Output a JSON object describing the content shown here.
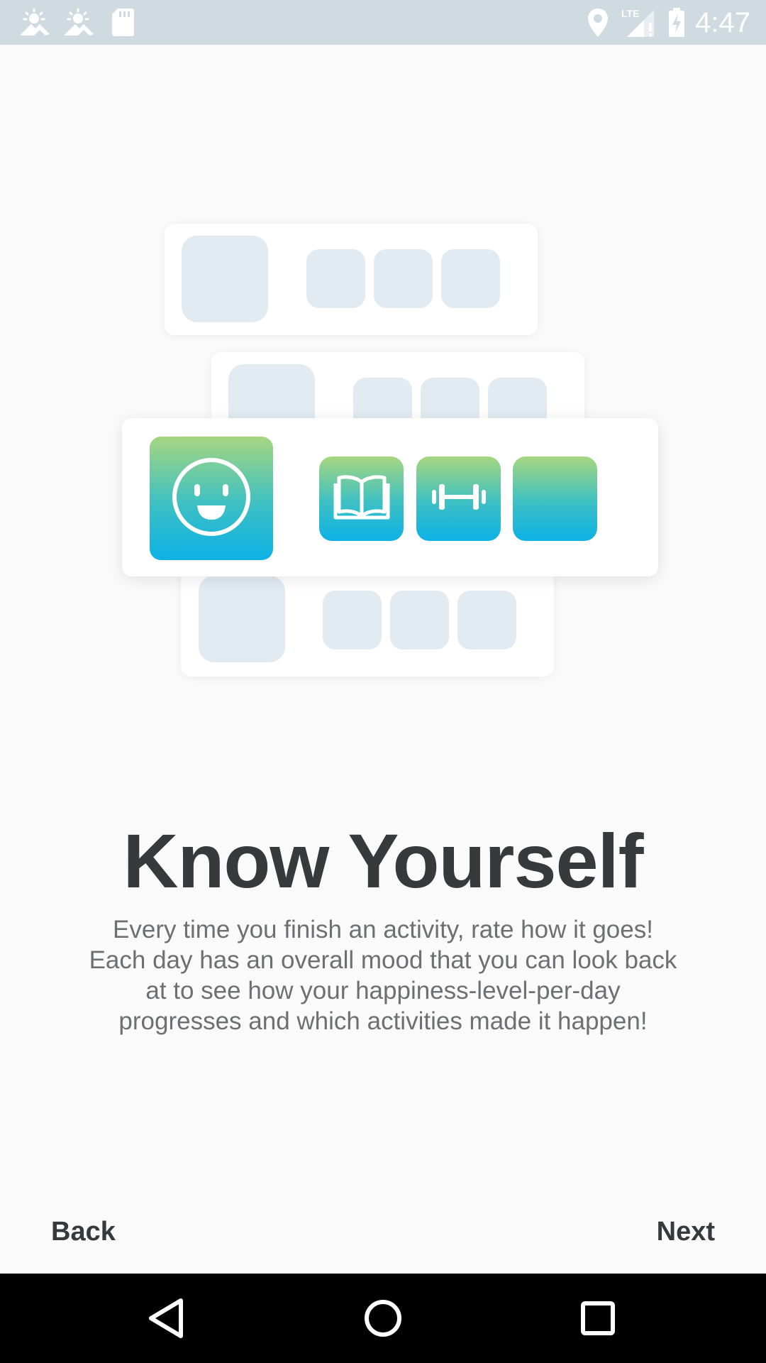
{
  "status_bar": {
    "time": "4:47",
    "background_color": "#cfdbe1",
    "left_icons": [
      "weather-icon",
      "weather-icon",
      "sd-card-icon"
    ],
    "right_icons": [
      "location-icon",
      "lte-signal-icon",
      "battery-charging-icon"
    ],
    "network_label": "LTE"
  },
  "illustration": {
    "highlight_icons": [
      "smiley-face-icon",
      "book-icon",
      "dumbbell-icon"
    ],
    "gradient_colors": [
      "#a6d67f",
      "#0db1e6"
    ],
    "placeholder_color": "#e1ebf1"
  },
  "content": {
    "title": "Know Yourself",
    "description": "Every time you finish an activity, rate how it goes! Each day has an overall mood that you can look back at to see how your happiness-level-per-day progresses and which activities made it happen!"
  },
  "buttons": {
    "back_label": "Back",
    "next_label": "Next"
  },
  "nav_bar": {
    "icons": [
      "back-triangle-icon",
      "home-circle-icon",
      "recents-square-icon"
    ]
  }
}
